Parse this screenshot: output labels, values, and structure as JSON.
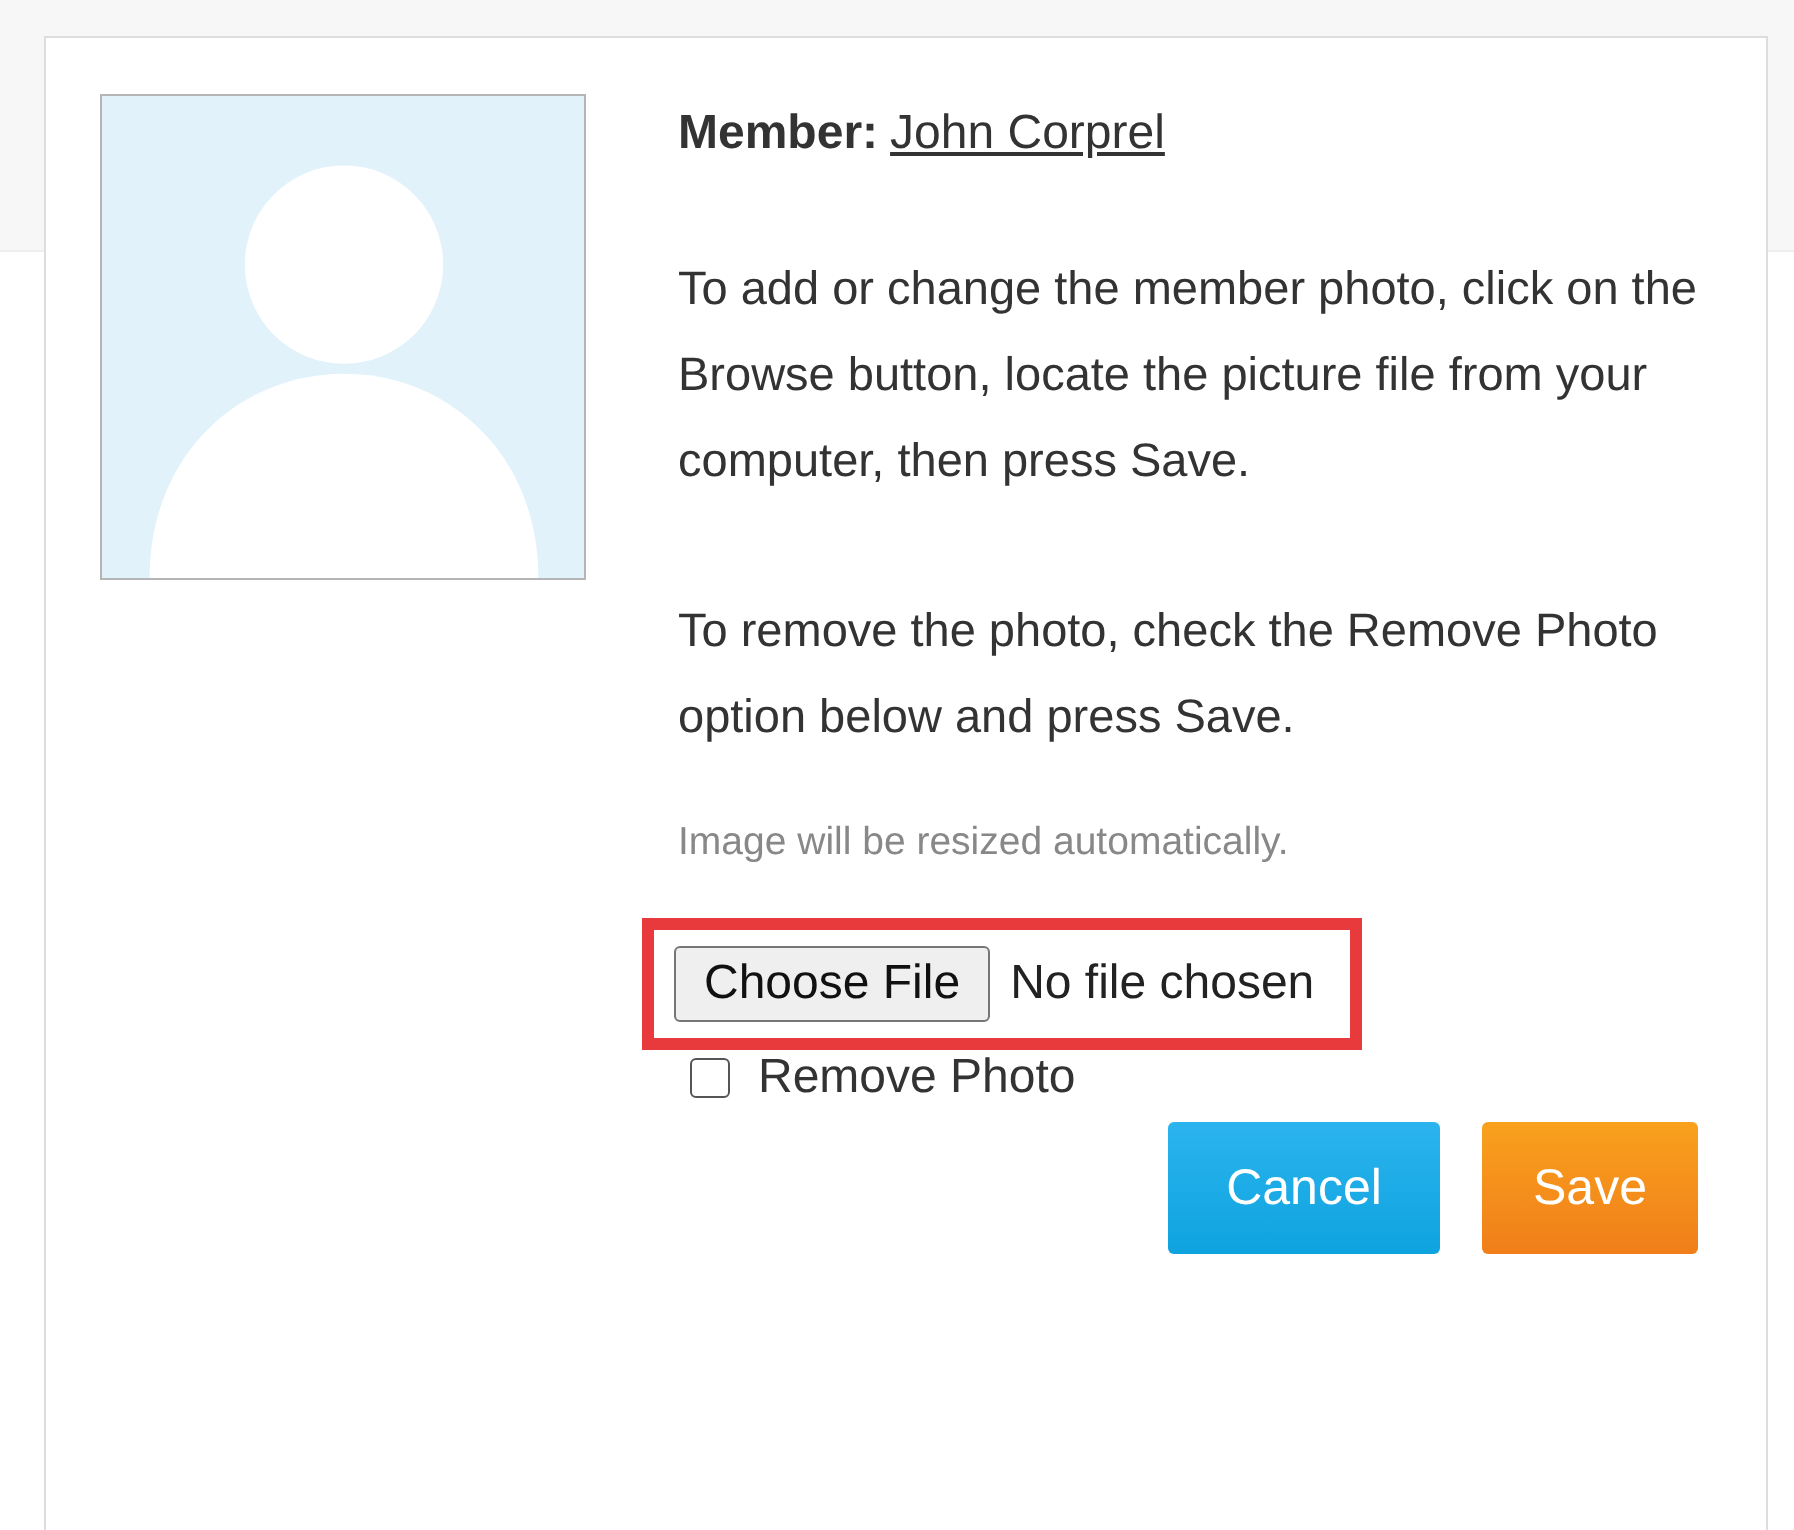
{
  "dialog": {
    "member_label": "Member:",
    "member_name": "John Corprel",
    "paragraphs": [
      "To add or change the member photo, click on the Browse button, locate the picture file from your computer, then press Save.",
      "To remove the photo, check the Remove Photo option below and press Save."
    ],
    "hint": "Image will be resized automatically.",
    "file_input": {
      "button": "Choose File",
      "status": "No file chosen",
      "highlighted": true
    },
    "remove_photo": {
      "label": "Remove Photo",
      "checked": false
    },
    "buttons": [
      {
        "label": "Cancel",
        "kind": "secondary"
      },
      {
        "label": "Save",
        "kind": "primary"
      }
    ]
  }
}
